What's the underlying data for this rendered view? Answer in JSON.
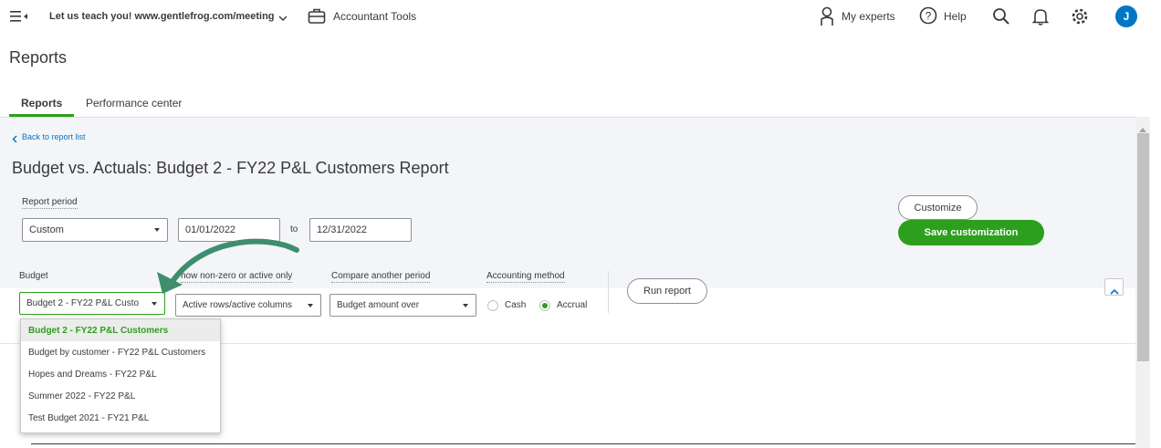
{
  "topbar": {
    "company": "Let us teach you! www.gentlefrog.com/meeting",
    "accountant_tools": "Accountant Tools",
    "my_experts": "My experts",
    "help": "Help",
    "avatar_initial": "J"
  },
  "page": {
    "title": "Reports",
    "tabs": [
      {
        "label": "Reports",
        "active": true
      },
      {
        "label": "Performance center",
        "active": false
      }
    ]
  },
  "report": {
    "back_link": "Back to report list",
    "title": "Budget vs. Actuals: Budget 2 - FY22 P&L Customers Report",
    "period_label": "Report period",
    "period_value": "Custom",
    "date_from": "01/01/2022",
    "to_label": "to",
    "date_to": "12/31/2022",
    "customize": "Customize",
    "save_customization": "Save customization",
    "budget_label": "Budget",
    "budget_value": "Budget 2 - FY22 P&L Custo",
    "show_label": "how non-zero or active only",
    "show_value": "Active rows/active columns",
    "compare_label": "Compare another period",
    "compare_value": "Budget amount over",
    "accounting_label": "Accounting method",
    "cash": "Cash",
    "accrual": "Accrual",
    "accounting_selected": "Accrual",
    "run_report": "Run report"
  },
  "budget_options": [
    {
      "label": "Budget 2 - FY22 P&L Customers",
      "selected": true
    },
    {
      "label": "Budget by customer - FY22 P&L Customers",
      "selected": false
    },
    {
      "label": "Hopes and Dreams - FY22 P&L",
      "selected": false
    },
    {
      "label": "Summer 2022 - FY22 P&L",
      "selected": false
    },
    {
      "label": "Test Budget 2021 - FY21 P&L",
      "selected": false
    }
  ],
  "colors": {
    "accent_green": "#2ca01c",
    "link_blue": "#0077c5",
    "arrow_green": "#3e8e6e"
  }
}
